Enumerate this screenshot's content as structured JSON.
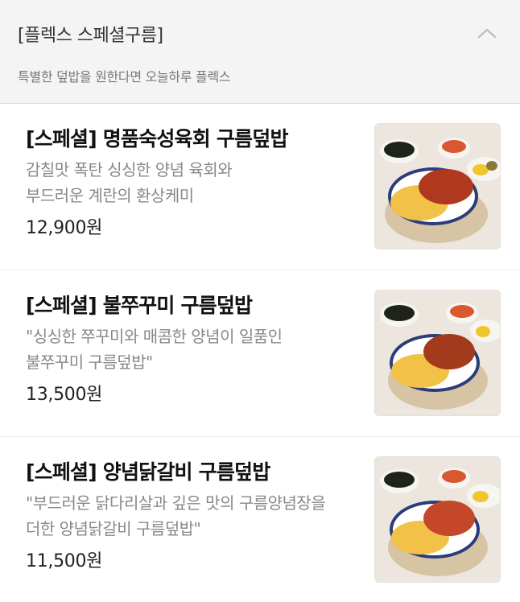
{
  "section": {
    "title": "[플렉스 스페셜구름]",
    "description": "특별한 덮밥을 원한다면 오늘하루 플렉스",
    "collapse_icon": "chevron-up-icon"
  },
  "menu": [
    {
      "name": "[스페셜] 명품숙성육회 구름덮밥",
      "desc_line1": "감칠맛 폭탄 싱싱한 양념 육회와",
      "desc_line2": "부드러운 계란의 환상케미",
      "price": "12,900원",
      "topping_color": "#b0381e"
    },
    {
      "name": "[스페셜] 불쭈꾸미 구름덮밥",
      "desc_line1": "\"싱싱한 쭈꾸미와 매콤한 양념이 일품인",
      "desc_line2": "불쭈꾸미 구름덮밥\"",
      "price": "13,500원",
      "topping_color": "#a43a1c"
    },
    {
      "name": "[스페셜] 양념닭갈비 구름덮밥",
      "desc_line1": "\"부드러운 닭다리살과 깊은 맛의 구름양념장을",
      "desc_line2": "더한 양념닭갈비 구름덮밥\"",
      "price": "11,500원",
      "topping_color": "#c4472a"
    }
  ]
}
